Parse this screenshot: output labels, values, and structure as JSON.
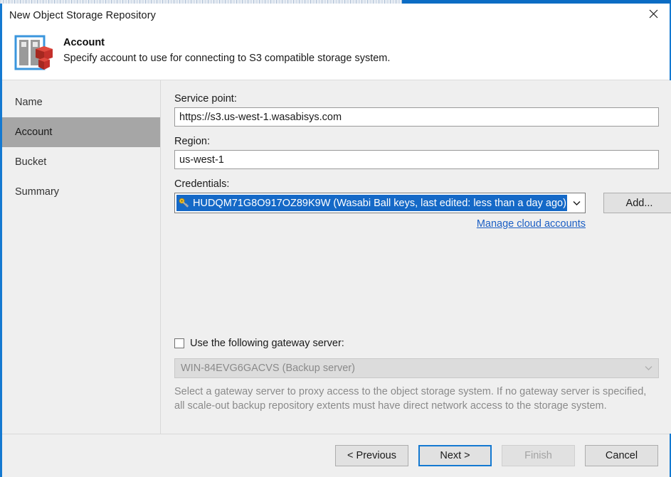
{
  "window": {
    "title": "New Object Storage Repository",
    "close_icon": "close-icon"
  },
  "header": {
    "icon": "object-storage-repository-icon",
    "title": "Account",
    "description": "Specify account to use for connecting to S3 compatible storage system."
  },
  "sidebar": {
    "items": [
      {
        "label": "Name",
        "selected": false
      },
      {
        "label": "Account",
        "selected": true
      },
      {
        "label": "Bucket",
        "selected": false
      },
      {
        "label": "Summary",
        "selected": false
      }
    ]
  },
  "form": {
    "service_point": {
      "label": "Service point:",
      "value": "https://s3.us-west-1.wasabisys.com"
    },
    "region": {
      "label": "Region:",
      "value": "us-west-1"
    },
    "credentials": {
      "label": "Credentials:",
      "value": "HUDQM71G8O917OZ89K9W (Wasabi Ball keys, last edited: less than a day ago)",
      "icon": "key-icon",
      "dropdown_icon": "chevron-down-icon",
      "add_button": "Add...",
      "manage_link": "Manage cloud accounts",
      "selected_highlight_color": "#1569c7"
    },
    "gateway": {
      "checkbox_label": "Use the following gateway server:",
      "checked": false,
      "server_value": "WIN-84EVG6GACVS (Backup server)",
      "dropdown_icon": "chevron-down-icon",
      "enabled": false,
      "help_text": "Select a gateway server to proxy access to the object storage system. If no gateway server is specified, all scale-out backup repository extents must have direct network access to the storage system."
    }
  },
  "footer": {
    "previous": "< Previous",
    "next": "Next >",
    "finish": "Finish",
    "cancel": "Cancel",
    "default_button": "Next >",
    "disabled_button": "Finish",
    "accent_color": "#1479d1"
  }
}
